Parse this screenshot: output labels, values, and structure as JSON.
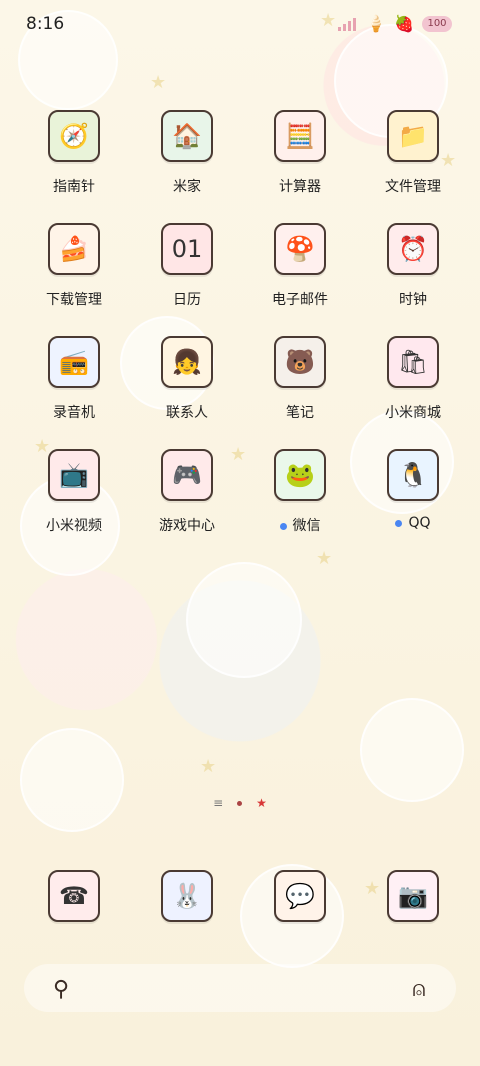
{
  "status": {
    "time": "8:16",
    "battery": "100",
    "signal": "signal-icon",
    "extra_icons": [
      "ice-cream-icon",
      "heart-icon"
    ]
  },
  "apps": [
    {
      "label": "指南针",
      "icon": "compass-icon",
      "glyph": "🧭",
      "bg": "#e9f3d9"
    },
    {
      "label": "米家",
      "icon": "mi-home-icon",
      "glyph": "🏠",
      "bg": "#e8f5e9"
    },
    {
      "label": "计算器",
      "icon": "calculator-icon",
      "glyph": "🧮",
      "bg": "#fff0ec"
    },
    {
      "label": "文件管理",
      "icon": "folder-icon",
      "glyph": "📁",
      "bg": "#fff2cf"
    },
    {
      "label": "下载管理",
      "icon": "download-icon",
      "glyph": "🍰",
      "bg": "#fff4e8"
    },
    {
      "label": "日历",
      "icon": "calendar-icon",
      "glyph": "01",
      "bg": "#ffe6e6"
    },
    {
      "label": "电子邮件",
      "icon": "mail-icon",
      "glyph": "🍄",
      "bg": "#fff0ee"
    },
    {
      "label": "时钟",
      "icon": "clock-icon",
      "glyph": "⏰",
      "bg": "#ffecec"
    },
    {
      "label": "录音机",
      "icon": "recorder-icon",
      "glyph": "📻",
      "bg": "#eef3ff"
    },
    {
      "label": "联系人",
      "icon": "contacts-icon",
      "glyph": "👧",
      "bg": "#fff5e2"
    },
    {
      "label": "笔记",
      "icon": "notes-icon",
      "glyph": "🐻",
      "bg": "#f5f0ea"
    },
    {
      "label": "小米商城",
      "icon": "mi-store-icon",
      "glyph": "🛍",
      "bg": "#ffe8ee"
    },
    {
      "label": "小米视频",
      "icon": "video-icon",
      "glyph": "📺",
      "bg": "#ffeaea"
    },
    {
      "label": "游戏中心",
      "icon": "game-center-icon",
      "glyph": "🎮",
      "bg": "#ffeaea"
    },
    {
      "label": "微信",
      "icon": "wechat-icon",
      "glyph": "🐸",
      "bg": "#eaf8ea",
      "dot": true
    },
    {
      "label": "QQ",
      "icon": "qq-icon",
      "glyph": "🐧",
      "bg": "#e9f4ff",
      "dot": true
    }
  ],
  "dock": [
    {
      "icon": "phone-icon",
      "glyph": "☎",
      "bg": "#ffecec"
    },
    {
      "icon": "browser-icon",
      "glyph": "🐰",
      "bg": "#eef2ff"
    },
    {
      "icon": "messages-icon",
      "glyph": "💬",
      "bg": "#fff3e9"
    },
    {
      "icon": "camera-icon",
      "glyph": "📷",
      "bg": "#fff0f5"
    }
  ],
  "page_indicator": {
    "lines": "≡",
    "star": "★"
  },
  "search": {
    "search_icon": "⚲",
    "assistant_icon": "⍝"
  }
}
